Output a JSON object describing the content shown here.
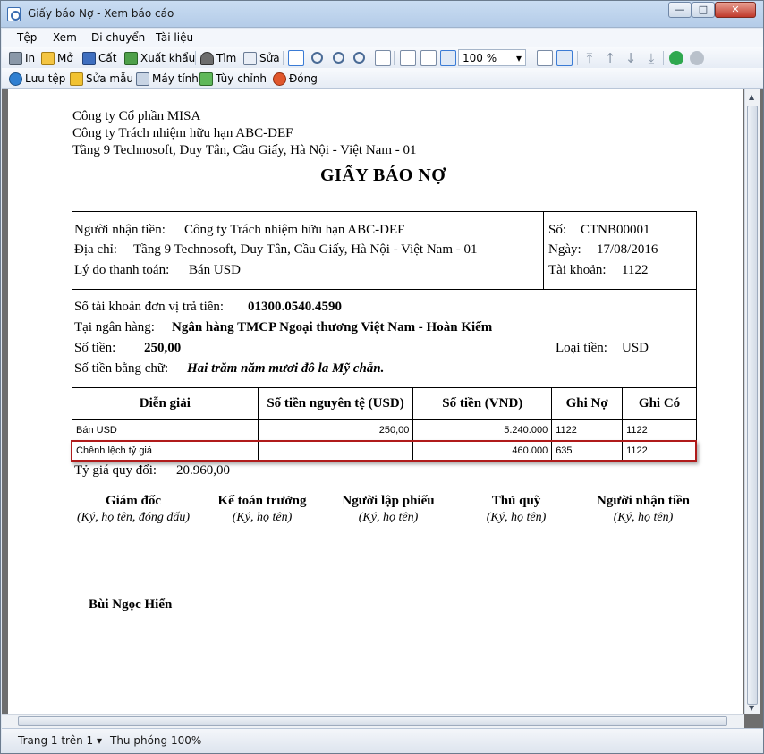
{
  "window": {
    "title": "Giấy báo Nợ - Xem báo cáo",
    "controls": {
      "minimize": "—",
      "maximize": "□",
      "close": "✕"
    }
  },
  "menu": [
    "Tệp",
    "Xem",
    "Di chuyển",
    "Tài liệu"
  ],
  "toolbar1": {
    "print": "In",
    "open": "Mở",
    "save": "Cất",
    "export": "Xuất khẩu",
    "find": "Tìm",
    "edit": "Sửa",
    "zoom_value": "100 %"
  },
  "toolbar2": {
    "save_file": "Lưu tệp",
    "edit_template": "Sửa mẫu",
    "printer": "Máy tính",
    "customize": "Tùy chỉnh",
    "close": "Đóng"
  },
  "document": {
    "company": "Công ty Cổ phần MISA",
    "payee_company": "Công ty Trách nhiệm hữu hạn ABC-DEF",
    "address_line": "Tầng 9 Technosoft, Duy Tân, Cầu Giấy, Hà Nội - Việt Nam - 01",
    "title": "GIẤY BÁO NỢ",
    "recipient_label": "Người nhận tiền:",
    "recipient_value": "Công ty Trách nhiệm hữu hạn ABC-DEF",
    "address_label": "Địa chỉ:",
    "address_value": "Tầng 9 Technosoft, Duy Tân, Cầu Giấy, Hà Nội - Việt Nam - 01",
    "reason_label": "Lý do thanh toán:",
    "reason_value": "Bán USD",
    "number_label": "Số:",
    "number_value": "CTNB00001",
    "date_label": "Ngày:",
    "date_value": "17/08/2016",
    "account_label": "Tài khoản:",
    "account_value": "1122",
    "payer_account_label": "Số tài khoản đơn vị trả tiền:",
    "payer_account_value": "01300.0540.4590",
    "bank_label": "Tại ngân hàng:",
    "bank_value": "Ngân hàng TMCP Ngoại thương Việt Nam - Hoàn Kiếm",
    "amount_label": "Số tiền:",
    "amount_value": "250,00",
    "currency_label": "Loại tiền:",
    "currency_value": "USD",
    "amount_words_label": "Số tiền bằng chữ:",
    "amount_words_value": "Hai trăm năm mươi đô la Mỹ chẵn.",
    "table": {
      "headers": [
        "Diễn giải",
        "Số tiền nguyên tệ  (USD)",
        "Số tiền (VND)",
        "Ghi Nợ",
        "Ghi Có"
      ],
      "rows": [
        [
          "Bán USD",
          "250,00",
          "5.240.000",
          "1122",
          "1122"
        ],
        [
          "Chênh lệch tỷ giá",
          "",
          "460.000",
          "635",
          "1122"
        ]
      ]
    },
    "rate_label": "Tỷ giá quy đổi:",
    "rate_value": "20.960,00",
    "signatures": [
      {
        "role": "Giám đốc",
        "note": "(Ký, họ tên, đóng dấu)"
      },
      {
        "role": "Kế toán trưởng",
        "note": "(Ký, họ tên)"
      },
      {
        "role": "Người lập phiếu",
        "note": "(Ký, họ tên)"
      },
      {
        "role": "Thủ quỹ",
        "note": "(Ký, họ tên)"
      },
      {
        "role": "Người nhận tiền",
        "note": "(Ký, họ tên)"
      }
    ],
    "signer_name": "Bùi Ngọc Hiển"
  },
  "status": {
    "page": "Trang 1 trên 1",
    "zoom": "Thu phóng 100%"
  },
  "colors": {
    "highlight_border": "#b01b1b",
    "viewer_background": "#6e6e6e"
  }
}
